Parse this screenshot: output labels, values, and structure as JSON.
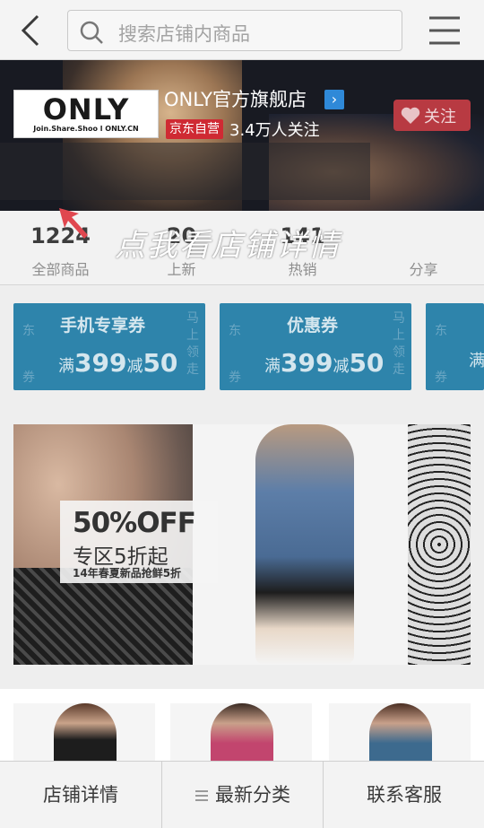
{
  "search": {
    "placeholder": "搜索店铺内商品"
  },
  "store": {
    "logo_text": "ONLY",
    "logo_tagline": "Join.Share.Shoo l ONLY.CN",
    "name": "ONLY官方旗舰店",
    "badge": "京东自营",
    "followers": "3.4万人关注",
    "follow_label": "关注"
  },
  "stats": [
    {
      "value": "1224",
      "label": "全部商品"
    },
    {
      "value": "20",
      "label": "上新"
    },
    {
      "value": "141",
      "label": "热销"
    },
    {
      "value": "",
      "label": "分享"
    }
  ],
  "hint": "点我看店铺详情",
  "coupons": [
    {
      "title": "手机专享券",
      "left_top": "东",
      "left_bottom": "券",
      "prefix": "满",
      "amount": "399",
      "mid": "减",
      "discount": "50",
      "right": "马上领走"
    },
    {
      "title": "优惠券",
      "left_top": "东",
      "left_bottom": "券",
      "prefix": "满",
      "amount": "399",
      "mid": "减",
      "discount": "50",
      "right": "马上领走"
    },
    {
      "title": "",
      "left_top": "东",
      "left_bottom": "券",
      "prefix": "满",
      "amount": "",
      "mid": "",
      "discount": "",
      "right": ""
    }
  ],
  "promo": {
    "headline": "50%OFF",
    "subline": "专区5折起",
    "note": "14年春夏新品抢鲜5折"
  },
  "bottom_nav": [
    {
      "label": "店铺详情"
    },
    {
      "label": "最新分类"
    },
    {
      "label": "联系客服"
    }
  ],
  "colors": {
    "coupon_bg": "#2e84ab",
    "follow_bg": "#b83a42",
    "badge_bg": "#cf2a33",
    "store_arrow": "#2f89d8"
  }
}
